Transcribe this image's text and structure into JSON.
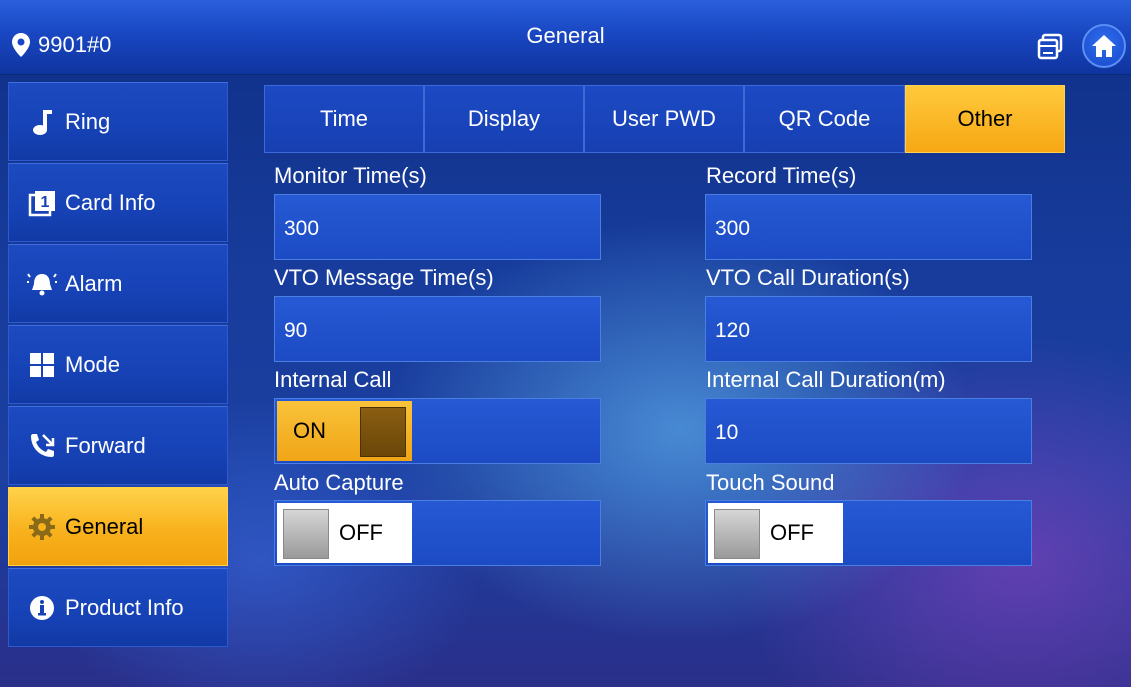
{
  "header": {
    "location": "9901#0",
    "title": "General",
    "icons": [
      "location-pin-icon",
      "multi-window-icon",
      "home-icon"
    ]
  },
  "sidebar": {
    "items": [
      {
        "label": "Ring",
        "icon": "music-note-icon",
        "active": false
      },
      {
        "label": "Card Info",
        "icon": "card-icon",
        "active": false
      },
      {
        "label": "Alarm",
        "icon": "alarm-bell-icon",
        "active": false
      },
      {
        "label": "Mode",
        "icon": "mode-grid-icon",
        "active": false
      },
      {
        "label": "Forward",
        "icon": "call-forward-icon",
        "active": false
      },
      {
        "label": "General",
        "icon": "gear-icon",
        "active": true
      },
      {
        "label": "Product Info",
        "icon": "info-icon",
        "active": false
      }
    ]
  },
  "tabs": [
    {
      "label": "Time",
      "active": false
    },
    {
      "label": "Display",
      "active": false
    },
    {
      "label": "User PWD",
      "active": false
    },
    {
      "label": "QR Code",
      "active": false
    },
    {
      "label": "Other",
      "active": true
    }
  ],
  "fields": {
    "monitor_time": {
      "label": "Monitor Time(s)",
      "value": "300"
    },
    "record_time": {
      "label": "Record Time(s)",
      "value": "300"
    },
    "vto_message_time": {
      "label": "VTO Message Time(s)",
      "value": "90"
    },
    "vto_call_duration": {
      "label": "VTO Call Duration(s)",
      "value": "120"
    },
    "internal_call": {
      "label": "Internal Call",
      "state": "ON"
    },
    "internal_call_duration": {
      "label": "Internal Call Duration(m)",
      "value": "10"
    },
    "auto_capture": {
      "label": "Auto Capture",
      "state": "OFF"
    },
    "touch_sound": {
      "label": "Touch Sound",
      "state": "OFF"
    }
  },
  "colors": {
    "accent": "#f8b21d",
    "panel_blue": "#1c4bc4",
    "header_blue": "#1947c2"
  }
}
